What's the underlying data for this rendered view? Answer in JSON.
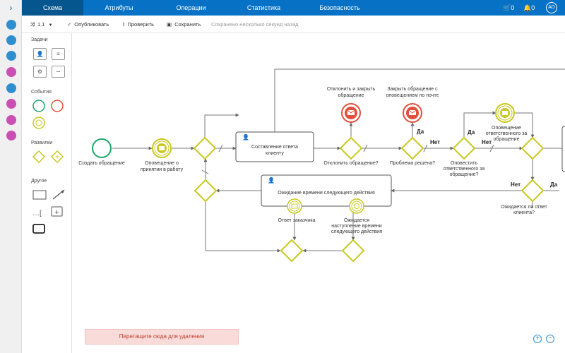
{
  "topnav": {
    "tabs": [
      "Схема",
      "Атрибуты",
      "Операции",
      "Статистика",
      "Безопасность"
    ],
    "cart_count": "0",
    "notif_count": "0",
    "avatar": "AD"
  },
  "toolbar": {
    "version": "1.1",
    "publish": "Опубликовать",
    "check": "Проверить",
    "save": "Сохранить",
    "status": "Сохранено несколько секунд назад"
  },
  "palette": {
    "tasks": "Задачи",
    "events": "События",
    "gateways": "Развилки",
    "other": "Другое"
  },
  "diagram": {
    "create_request": "Создать обращение",
    "notify_accepted": [
      "Оповещение о",
      "принятии в работу"
    ],
    "compose_answer": [
      "Составление ответа",
      "клиенту"
    ],
    "reject_close": [
      "Отклонить и закрыть",
      "обращение"
    ],
    "close_notify": [
      "Закрыть обращение с",
      "оповещением по почте"
    ],
    "reject_q": "Отклонить обращение?",
    "solved_q": "Проблема решена?",
    "notify_resp_q": [
      "Оповестить",
      "ответственного за",
      "обращение?"
    ],
    "notify_resp": [
      "Оповещение",
      "ответственного за",
      "обращение"
    ],
    "wait_answer_q": [
      "Ожидается ли ответ",
      "клиента?"
    ],
    "wait_next": "Ожидание времени следующего действия",
    "customer_answer": "Ответ заказчика",
    "wait_time": [
      "Ожидается",
      "наступление времени",
      "следующего действия"
    ],
    "yes": "Да",
    "no": "Нет"
  },
  "dropzone": "Перетащите сюда для удаления",
  "colors": {
    "nav": "#0772c5",
    "nav_active": "#05558f",
    "start_event": "#1aa86a",
    "intermediate": "#c8c820",
    "end_event": "#e0503c",
    "gateway": "#c8c820"
  }
}
